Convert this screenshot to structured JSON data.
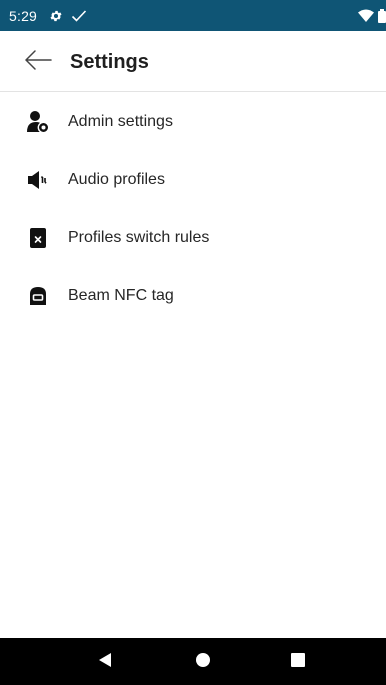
{
  "status_bar": {
    "time": "5:29",
    "background": "#0f5575",
    "icons": [
      "gear-icon",
      "check-icon",
      "wifi-icon",
      "battery-icon"
    ]
  },
  "app_bar": {
    "title": "Settings",
    "back_icon": "arrow-left-icon"
  },
  "settings": {
    "items": [
      {
        "label": "Admin settings",
        "icon": "admin-person-icon"
      },
      {
        "label": "Audio profiles",
        "icon": "speaker-icon"
      },
      {
        "label": "Profiles switch rules",
        "icon": "rules-icon"
      },
      {
        "label": "Beam NFC tag",
        "icon": "nfc-tag-icon"
      }
    ]
  },
  "nav_bar": {
    "background": "#000000",
    "buttons": [
      "back-triangle-icon",
      "home-circle-icon",
      "recents-square-icon"
    ]
  }
}
